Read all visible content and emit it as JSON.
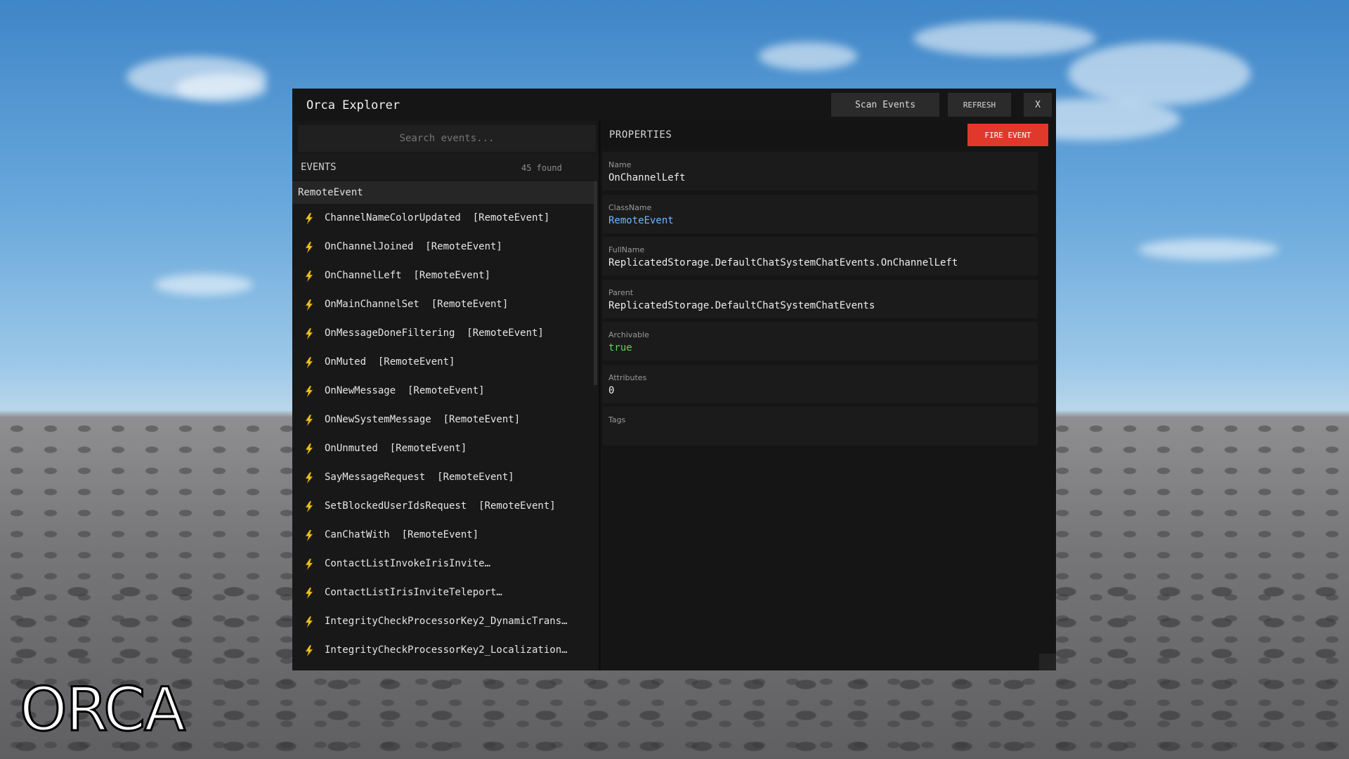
{
  "watermark": "ORCA",
  "window": {
    "title": "Orca Explorer",
    "scan_label": "Scan Events",
    "refresh_label": "REFRESH",
    "close_label": "X"
  },
  "left": {
    "search_placeholder": "Search events...",
    "events_label": "EVENTS",
    "events_count": "45 found",
    "group_label": "RemoteEvent",
    "items": [
      {
        "label": "ChannelNameColorUpdated  [RemoteEvent]",
        "icon": "lightning-icon"
      },
      {
        "label": "OnChannelJoined  [RemoteEvent]",
        "icon": "lightning-icon"
      },
      {
        "label": "OnChannelLeft  [RemoteEvent]",
        "icon": "lightning-icon"
      },
      {
        "label": "OnMainChannelSet  [RemoteEvent]",
        "icon": "lightning-icon"
      },
      {
        "label": "OnMessageDoneFiltering  [RemoteEvent]",
        "icon": "lightning-icon"
      },
      {
        "label": "OnMuted  [RemoteEvent]",
        "icon": "lightning-icon"
      },
      {
        "label": "OnNewMessage  [RemoteEvent]",
        "icon": "lightning-icon"
      },
      {
        "label": "OnNewSystemMessage  [RemoteEvent]",
        "icon": "lightning-icon"
      },
      {
        "label": "OnUnmuted  [RemoteEvent]",
        "icon": "lightning-icon"
      },
      {
        "label": "SayMessageRequest  [RemoteEvent]",
        "icon": "lightning-icon"
      },
      {
        "label": "SetBlockedUserIdsRequest  [RemoteEvent]",
        "icon": "lightning-icon"
      },
      {
        "label": "CanChatWith  [RemoteEvent]",
        "icon": "lightning-icon"
      },
      {
        "label": "ContactListInvokeIrisInvite…",
        "icon": "lightning-icon"
      },
      {
        "label": "ContactListIrisInviteTeleport…",
        "icon": "lightning-icon"
      },
      {
        "label": "IntegrityCheckProcessorKey2_DynamicTrans…",
        "icon": "lightning-icon"
      },
      {
        "label": "IntegrityCheckProcessorKey2_Localization…",
        "icon": "lightning-icon"
      }
    ]
  },
  "right": {
    "properties_label": "PROPERTIES",
    "fire_label": "FIRE EVENT",
    "props": [
      {
        "key": "Name",
        "value": "OnChannelLeft",
        "color": "#eeeeee"
      },
      {
        "key": "ClassName",
        "value": "RemoteEvent",
        "color": "#6fb6ff"
      },
      {
        "key": "FullName",
        "value": "ReplicatedStorage.DefaultChatSystemChatEvents.OnChannelLeft",
        "color": "#eeeeee"
      },
      {
        "key": "Parent",
        "value": "ReplicatedStorage.DefaultChatSystemChatEvents",
        "color": "#eeeeee"
      },
      {
        "key": "Archivable",
        "value": "true",
        "color": "#5fd35f"
      },
      {
        "key": "Attributes",
        "value": "0",
        "color": "#eeeeee"
      },
      {
        "key": "Tags",
        "value": "",
        "color": "#eeeeee"
      }
    ]
  },
  "colors": {
    "accent_fire": "#e0392b",
    "icon_yellow": "#f2c21b"
  }
}
